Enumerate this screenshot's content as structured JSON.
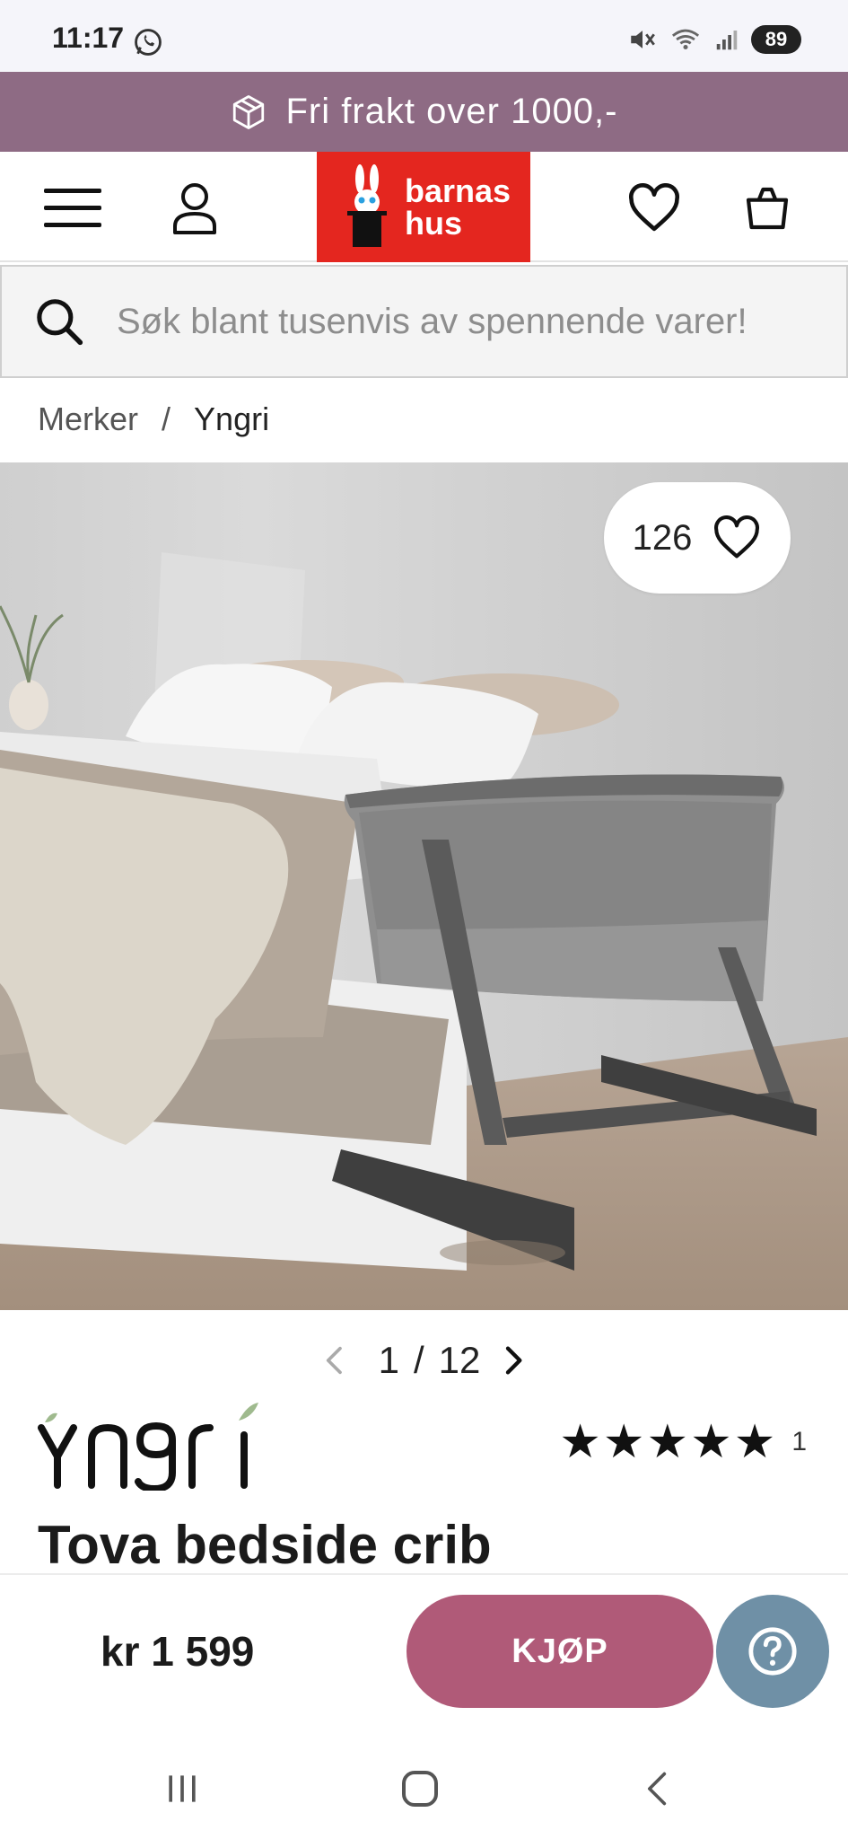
{
  "status_bar": {
    "time": "11:17",
    "battery": "89",
    "icons": [
      "whatsapp-icon",
      "mute-icon",
      "wifi-icon",
      "signal-icon"
    ]
  },
  "promo": {
    "icon": "box-icon",
    "text": "Fri frakt over 1000,-"
  },
  "header": {
    "logo_text_line1": "barnas",
    "logo_text_line2": "hus",
    "logo_color": "#e4261f",
    "icons": [
      "menu-icon",
      "account-icon",
      "wishlist-icon",
      "cart-icon"
    ]
  },
  "search": {
    "placeholder": "Søk blant tusenvis av spennende varer!"
  },
  "breadcrumb": {
    "items": [
      "Merker",
      "Yngri"
    ],
    "separator": "/"
  },
  "gallery": {
    "like_count": "126",
    "current": "1",
    "separator": "/",
    "total": "12"
  },
  "product": {
    "brand": "Yngri",
    "title": "Tova bedside crib",
    "rating_stars": "★★★★★",
    "rating": 5,
    "review_count": "1",
    "price": "kr 1 599"
  },
  "actions": {
    "buy_label": "KJØP",
    "buy_color": "#b05a78",
    "help_color": "#6f90a6"
  }
}
